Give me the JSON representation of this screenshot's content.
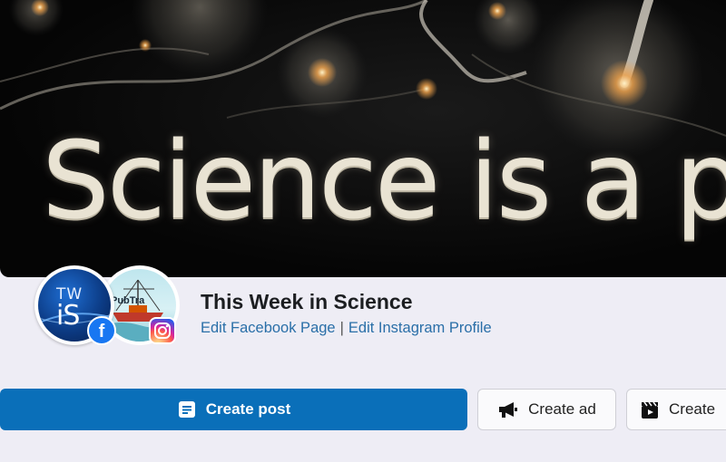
{
  "cover": {
    "headline": "Science is a pub"
  },
  "profile": {
    "primary_avatar_text_top": "TW",
    "primary_avatar_text_bottom": "iS",
    "secondary_avatar_text": "PubTra",
    "page_name": "This Week in Science",
    "edit_facebook_label": "Edit Facebook Page",
    "separator": "|",
    "edit_instagram_label": "Edit Instagram Profile",
    "facebook_badge": "f"
  },
  "actions": {
    "create_post_label": "Create post",
    "create_ad_label": "Create ad",
    "create_reel_label": "Create"
  },
  "icons": {
    "create_post": "post-icon",
    "create_ad": "megaphone-icon",
    "create_reel": "clapperboard-icon",
    "facebook": "facebook-icon",
    "instagram": "instagram-icon"
  },
  "colors": {
    "primary_button": "#0a6fb9",
    "link": "#2a6fa8",
    "facebook": "#1877f2"
  }
}
